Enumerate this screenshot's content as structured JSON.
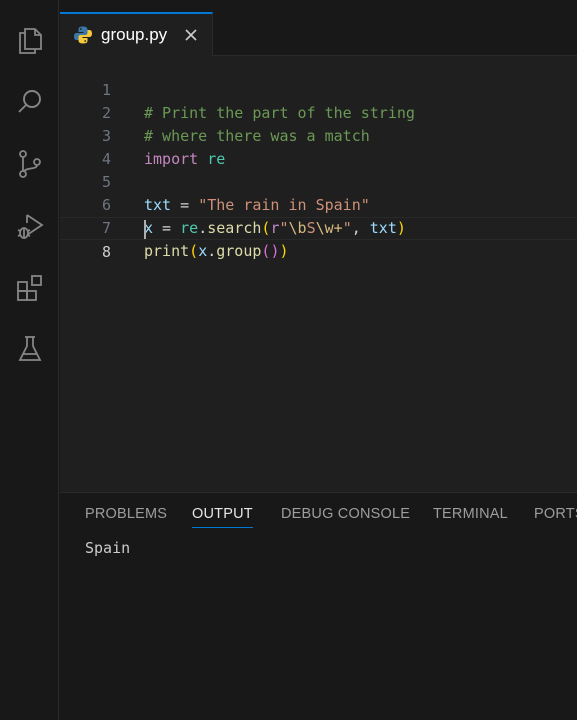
{
  "activity_bar": {
    "icons": [
      "explorer-icon",
      "search-icon",
      "source-control-icon",
      "run-debug-icon",
      "extensions-icon",
      "testing-icon"
    ]
  },
  "tab": {
    "filename": "group.py",
    "icon": "python-icon",
    "close_icon": "close-icon"
  },
  "editor": {
    "line_numbers": [
      "1",
      "2",
      "3",
      "4",
      "5",
      "6",
      "7",
      "8"
    ],
    "active_line": "8",
    "lines": {
      "l1_comment": "# Print the part of the string",
      "l2_comment": "# where there was a match",
      "l3_kw": "import",
      "l3_mod": "re",
      "l5_var": "txt",
      "l5_op": " = ",
      "l5_str": "\"The rain in Spain\"",
      "l6_var": "x",
      "l6_op": " = ",
      "l6_mod": "re",
      "l6_dot": ".",
      "l6_fn": "search",
      "l6_open": "(",
      "l6_prefix": "r",
      "l6_q1": "\"",
      "l6_esc1": "\\b",
      "l6_esc2": "S",
      "l6_esc3": "\\w",
      "l6_plus": "+",
      "l6_q2": "\"",
      "l6_comma": ", ",
      "l6_arg": "txt",
      "l6_close": ")",
      "l7_fn": "print",
      "l7_open1": "(",
      "l7_var": "x",
      "l7_dot": ".",
      "l7_fn2": "group",
      "l7_open2": "(",
      "l7_close2": ")",
      "l7_close1": ")"
    }
  },
  "panel": {
    "tabs": [
      "PROBLEMS",
      "OUTPUT",
      "DEBUG CONSOLE",
      "TERMINAL",
      "PORTS"
    ],
    "active_tab": "OUTPUT",
    "output": "Spain"
  },
  "colors": {
    "accent": "#0078d4",
    "comment": "#6a9955",
    "keyword": "#c586c0",
    "string": "#ce9178",
    "function": "#dcdcaa",
    "variable": "#9cdcfe"
  }
}
